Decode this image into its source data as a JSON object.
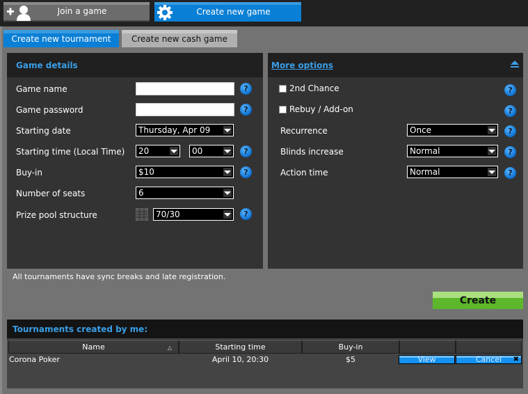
{
  "top_nav": {
    "join_label": "Join a game",
    "create_label": "Create new game",
    "join_icon": "add-user-icon",
    "create_icon": "gear-icon"
  },
  "sub_tabs": {
    "tournament_label": "Create new tournament",
    "cash_label": "Create new cash game",
    "active": "tournament"
  },
  "game_details": {
    "title": "Game details",
    "fields": {
      "game_name": {
        "label": "Game name",
        "value": ""
      },
      "game_password": {
        "label": "Game password",
        "value": ""
      },
      "starting_date": {
        "label": "Starting date",
        "value": "Thursday, Apr 09"
      },
      "starting_time": {
        "label": "Starting time (Local Time)",
        "hour": "20",
        "minute": "00"
      },
      "buy_in": {
        "label": "Buy-in",
        "value": "$10"
      },
      "seats": {
        "label": "Number of seats",
        "value": "6"
      },
      "prize_pool": {
        "label": "Prize pool structure",
        "value": "70/30"
      }
    },
    "help_glyph": "?"
  },
  "more_options": {
    "title": "More options",
    "collapse_icon": "collapse-up-icon",
    "second_chance": {
      "label": "2nd Chance",
      "checked": false
    },
    "rebuy": {
      "label": "Rebuy / Add-on",
      "checked": false
    },
    "recurrence": {
      "label": "Recurrence",
      "value": "Once"
    },
    "blinds": {
      "label": "Blinds increase",
      "value": "Normal"
    },
    "action_time": {
      "label": "Action time",
      "value": "Normal"
    }
  },
  "note": "All tournaments have sync breaks and late registration.",
  "create_button": "Create",
  "my_tournaments": {
    "title": "Tournaments created by me:",
    "columns": [
      "Name",
      "Starting time",
      "Buy-in",
      "",
      ""
    ],
    "rows": [
      {
        "name": "Corona Poker",
        "start": "April 10, 20:30",
        "buy_in": "$5",
        "view": "View",
        "cancel": "Cancel"
      }
    ]
  },
  "colors": {
    "accent_blue": "#0a7fd6",
    "link_blue": "#3a9ee6",
    "create_green": "#5cb82a"
  }
}
